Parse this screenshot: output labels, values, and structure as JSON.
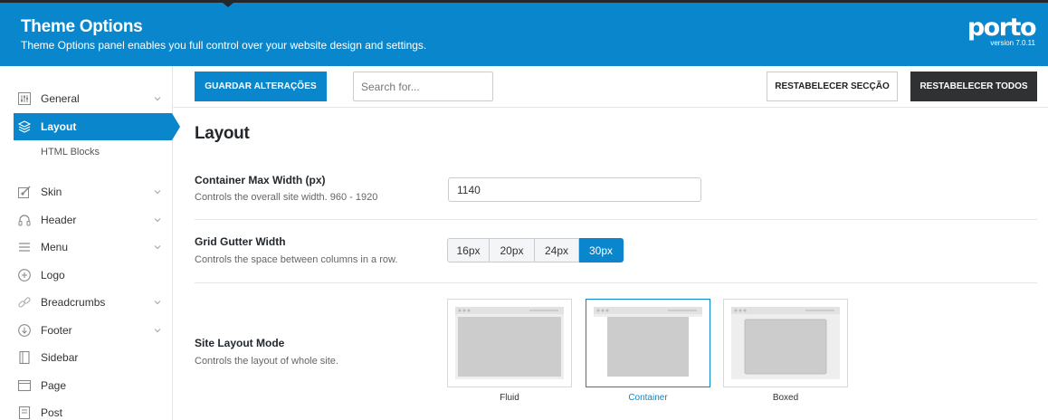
{
  "header": {
    "title": "Theme Options",
    "subtitle": "Theme Options panel enables you full control over your website design and settings.",
    "logo_text": "porto",
    "version": "version 7.0.11"
  },
  "sidebar": {
    "items": [
      {
        "label": "General",
        "icon": "sliders-icon",
        "has_chevron": true
      },
      {
        "label": "Layout",
        "icon": "layers-icon",
        "active": true
      },
      {
        "label": "Skin",
        "icon": "brush-icon",
        "has_chevron": true
      },
      {
        "label": "Header",
        "icon": "headphones-icon",
        "has_chevron": true
      },
      {
        "label": "Menu",
        "icon": "menu-icon",
        "has_chevron": true
      },
      {
        "label": "Logo",
        "icon": "plus-circle-icon"
      },
      {
        "label": "Breadcrumbs",
        "icon": "link-icon",
        "has_chevron": true
      },
      {
        "label": "Footer",
        "icon": "arrow-down-circle-icon",
        "has_chevron": true
      },
      {
        "label": "Sidebar",
        "icon": "sidebar-icon"
      },
      {
        "label": "Page",
        "icon": "window-icon"
      },
      {
        "label": "Post",
        "icon": "post-icon"
      }
    ],
    "sub_items": [
      {
        "label": "HTML Blocks"
      }
    ]
  },
  "toolbar": {
    "save_label": "GUARDAR ALTERAÇÕES",
    "search_placeholder": "Search for...",
    "reset_section_label": "RESTABELECER SECÇÃO",
    "reset_all_label": "RESTABELECER TODOS"
  },
  "main": {
    "section_title": "Layout",
    "container_width": {
      "label": "Container Max Width (px)",
      "description": "Controls the overall site width. 960 - 1920",
      "value": "1140"
    },
    "grid_gutter": {
      "label": "Grid Gutter Width",
      "description": "Controls the space between columns in a row.",
      "options": [
        "16px",
        "20px",
        "24px",
        "30px"
      ],
      "selected": "30px"
    },
    "site_layout": {
      "label": "Site Layout Mode",
      "description": "Controls the layout of whole site.",
      "options": [
        "Fluid",
        "Container",
        "Boxed"
      ],
      "selected": "Container"
    }
  },
  "colors": {
    "accent": "#0a86cd",
    "dark_button": "#2f3133",
    "header_strip": "#23282d"
  }
}
